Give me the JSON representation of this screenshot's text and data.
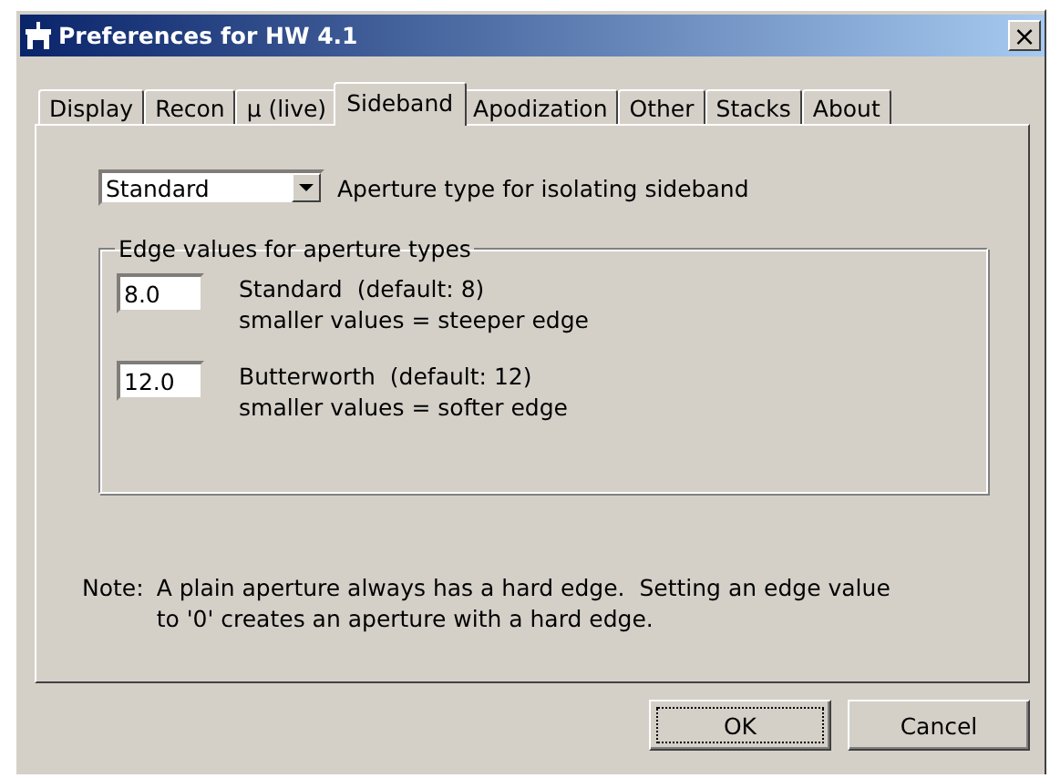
{
  "window": {
    "title": "Preferences for HW 4.1",
    "close": "×"
  },
  "tabs": [
    {
      "label": "Display",
      "selected": false
    },
    {
      "label": "Recon",
      "selected": false
    },
    {
      "label": "µ (live)",
      "selected": false
    },
    {
      "label": "Sideband",
      "selected": true
    },
    {
      "label": "Apodization",
      "selected": false
    },
    {
      "label": "Other",
      "selected": false
    },
    {
      "label": "Stacks",
      "selected": false
    },
    {
      "label": "About",
      "selected": false
    }
  ],
  "aperture": {
    "value": "Standard",
    "label": "Aperture type for isolating sideband"
  },
  "edge_group": {
    "title": "Edge values for aperture types",
    "fields": [
      {
        "value": "8.0",
        "label": "Standard  (default: 8)",
        "hint": "smaller values = steeper edge"
      },
      {
        "value": "12.0",
        "label": "Butterworth  (default: 12)",
        "hint": "smaller values = softer edge"
      }
    ]
  },
  "note": {
    "label": "Note:",
    "lines": [
      "A plain aperture always has a hard edge.  Setting an edge value",
      "to '0' creates an aperture with a hard edge."
    ]
  },
  "buttons": [
    {
      "label": "OK",
      "default": true
    },
    {
      "label": "Cancel",
      "default": false
    }
  ]
}
